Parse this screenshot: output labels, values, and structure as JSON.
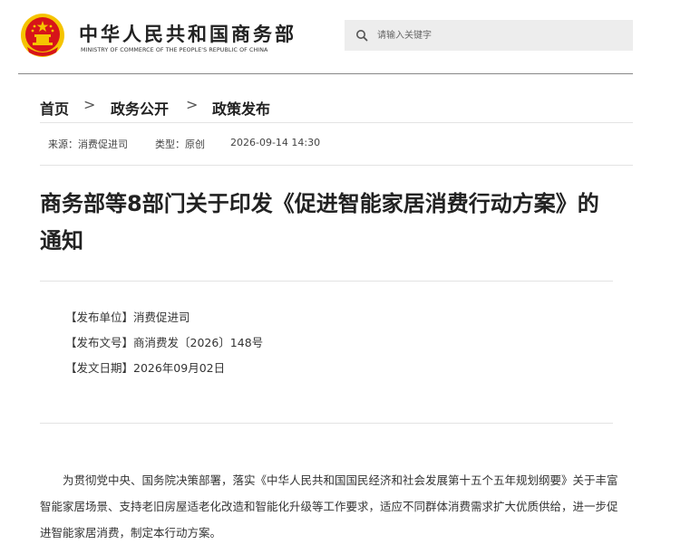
{
  "header": {
    "site_name_cn": "中华人民共和国商务部",
    "site_name_en": "MINISTRY OF COMMERCE OF THE PEOPLE'S REPUBLIC OF CHINA",
    "search_placeholder": "请输入关键字",
    "emblem_icon": "national-emblem-icon",
    "search_icon": "search-icon"
  },
  "breadcrumb": {
    "items": [
      "首页",
      "政务公开",
      "政策发布"
    ],
    "separator": ">"
  },
  "meta": {
    "source": "来源：消费促进司",
    "type": "类型：原创",
    "datetime": "2026-09-14 14:30"
  },
  "article": {
    "title": "商务部等8部门关于印发《促进智能家居消费行动方案》的通知",
    "info": [
      "【发布单位】消费促进司",
      "【发布文号】商消费发〔2026〕148号",
      "【发文日期】2026年09月02日"
    ],
    "body": "为贯彻党中央、国务院决策部署，落实《中华人民共和国国民经济和社会发展第十五个五年规划纲要》关于丰富智能家居场景、支持老旧房屋适老化改造和智能化升级等工作要求，适应不同群体消费需求扩大优质供给，进一步促进智能家居消费，制定本行动方案。"
  },
  "colors": {
    "emblem_red": "#d7141a",
    "emblem_gold": "#f5c400",
    "search_bg": "#ededed"
  }
}
